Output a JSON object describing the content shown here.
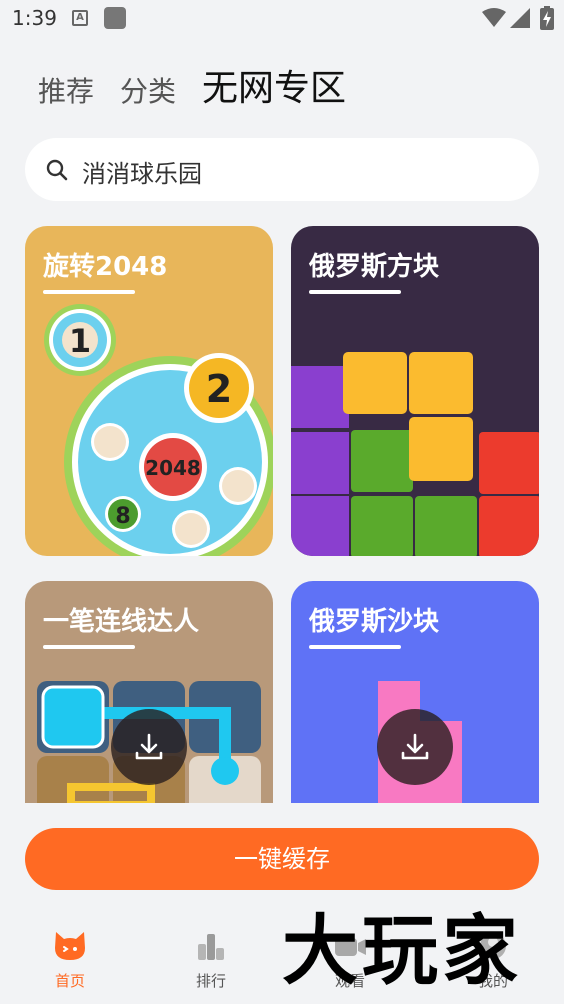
{
  "status": {
    "time": "1:39",
    "notif_letter": "A"
  },
  "tabs": [
    {
      "label": "推荐"
    },
    {
      "label": "分类"
    },
    {
      "label": "无网专区"
    }
  ],
  "search": {
    "placeholder": "消消球乐园"
  },
  "cards": [
    {
      "title": "旋转2048",
      "bg": "#e8b65a"
    },
    {
      "title": "俄罗斯方块",
      "bg": "#382a44"
    },
    {
      "title": "一笔连线达人",
      "bg": "#b8997a"
    },
    {
      "title": "俄罗斯沙块",
      "bg": "#5f72f6"
    }
  ],
  "game_2048": {
    "ball_1": "1",
    "ball_2": "2",
    "ball_2048": "2048",
    "ball_8": "8"
  },
  "cache_button": {
    "label": "一键缓存"
  },
  "bottom_nav": [
    {
      "label": "首页",
      "icon": "home-cat-icon",
      "active": true
    },
    {
      "label": "排行",
      "icon": "ranking-bars-icon"
    },
    {
      "label": "观看",
      "icon": "video-camera-icon"
    },
    {
      "label": "我的",
      "icon": "profile-icon"
    }
  ],
  "watermark": {
    "text": "大玩家"
  },
  "colors": {
    "accent": "#ff6a23"
  }
}
